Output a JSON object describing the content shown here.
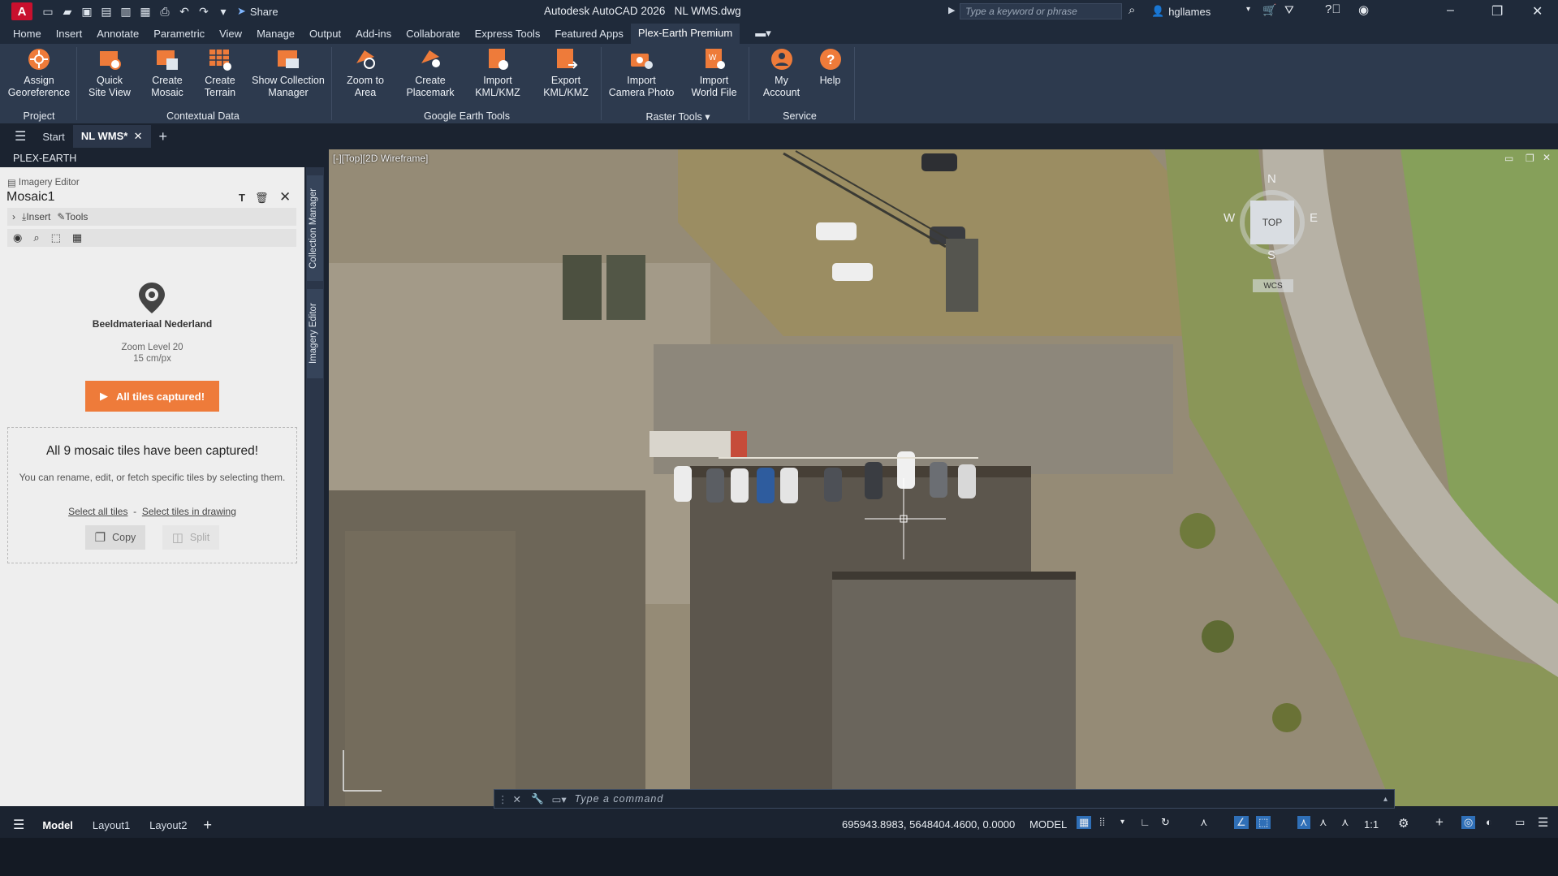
{
  "titlebar": {
    "logo": "A",
    "share": "Share",
    "title": "Autodesk AutoCAD 2026",
    "file": "NL WMS.dwg",
    "search_placeholder": "Type a keyword or phrase",
    "user": "hgllames"
  },
  "menu_tabs": [
    "Home",
    "Insert",
    "Annotate",
    "Parametric",
    "View",
    "Manage",
    "Output",
    "Add-ins",
    "Collaborate",
    "Express Tools",
    "Featured Apps",
    "Plex-Earth Premium"
  ],
  "ribbon": {
    "buttons": [
      {
        "l1": "Assign",
        "l2": "Georeference"
      },
      {
        "l1": "Quick",
        "l2": "Site View"
      },
      {
        "l1": "Create",
        "l2": "Mosaic"
      },
      {
        "l1": "Create",
        "l2": "Terrain"
      },
      {
        "l1": "Show Collection",
        "l2": "Manager"
      },
      {
        "l1": "Zoom to",
        "l2": "Area"
      },
      {
        "l1": "Create",
        "l2": "Placemark"
      },
      {
        "l1": "Import",
        "l2": "KML/KMZ"
      },
      {
        "l1": "Export",
        "l2": "KML/KMZ"
      },
      {
        "l1": "Import",
        "l2": "Camera Photo"
      },
      {
        "l1": "Import",
        "l2": "World File"
      },
      {
        "l1": "My",
        "l2": "Account"
      },
      {
        "l1": "Help",
        "l2": ""
      }
    ],
    "panels": [
      "Project",
      "Contextual Data",
      "Google Earth Tools",
      "Raster Tools",
      "Service"
    ]
  },
  "doc_tabs": {
    "start": "Start",
    "active": "NL WMS*"
  },
  "palette": {
    "title": "PLEX-EARTH",
    "section": "Imagery Editor",
    "mosaic_name": "Mosaic1",
    "insert": "Insert",
    "tools": "Tools",
    "provider": "Beeldmateriaal Nederland",
    "zoom_level": "Zoom Level 20",
    "resolution": "15 cm/px",
    "capture_button": "All tiles captured!",
    "captured_heading": "All 9 mosaic tiles have been captured!",
    "captured_desc": "You can rename, edit, or fetch specific tiles by selecting them.",
    "select_all": "Select all tiles",
    "dash": "-",
    "select_drawing": "Select tiles in drawing",
    "copy": "Copy",
    "split": "Split"
  },
  "side_tabs": {
    "collection": "Collection Manager",
    "imagery": "Imagery Editor"
  },
  "viewport": {
    "label": "[-][Top][2D Wireframe]"
  },
  "viewcube": {
    "n": "N",
    "s": "S",
    "e": "E",
    "w": "W",
    "top": "TOP",
    "wcs": "WCS"
  },
  "command": {
    "placeholder": "Type a command"
  },
  "status": {
    "model_tab": "Model",
    "layout1": "Layout1",
    "layout2": "Layout2",
    "coords": "695943.8983, 5648404.4600, 0.0000",
    "space": "MODEL",
    "scale": "1:1"
  },
  "colors": {
    "accent": "#ee7b3a",
    "ribbon": "#2d3a4e",
    "titlebar": "#1f2a3a"
  }
}
